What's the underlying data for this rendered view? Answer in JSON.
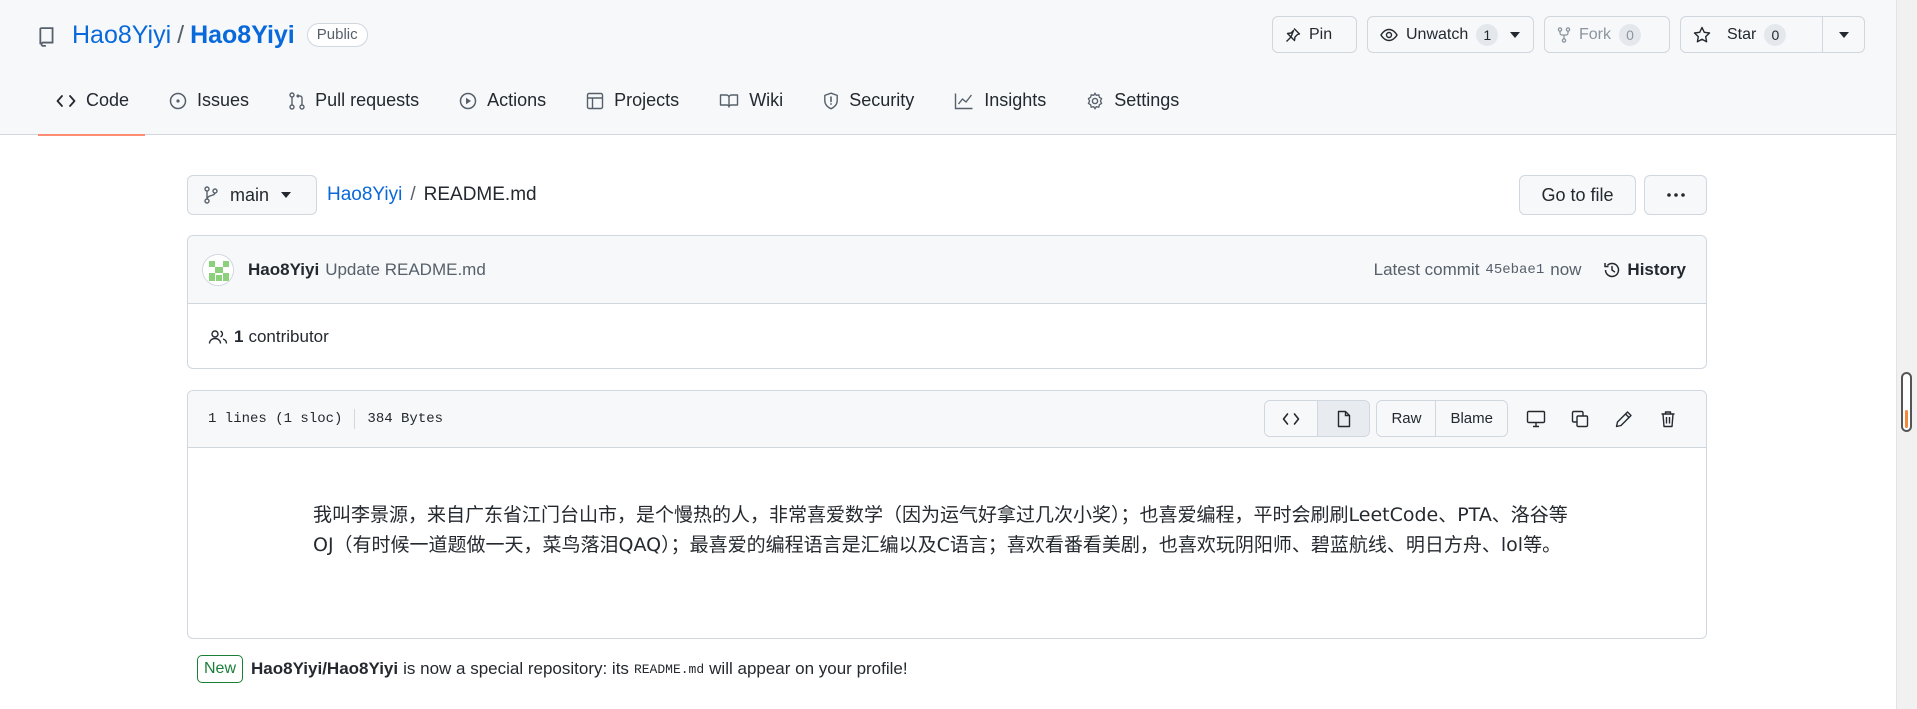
{
  "repo": {
    "owner": "Hao8Yiyi",
    "separator": "/",
    "name": "Hao8Yiyi",
    "visibility": "Public"
  },
  "header_actions": {
    "pin_label": "Pin",
    "unwatch_label": "Unwatch",
    "unwatch_count": "1",
    "fork_label": "Fork",
    "fork_count": "0",
    "star_label": "Star",
    "star_count": "0"
  },
  "tabs": [
    {
      "label": "Code",
      "icon": "code-icon",
      "active": true
    },
    {
      "label": "Issues",
      "icon": "issue-icon"
    },
    {
      "label": "Pull requests",
      "icon": "pull-request-icon"
    },
    {
      "label": "Actions",
      "icon": "play-icon"
    },
    {
      "label": "Projects",
      "icon": "table-icon"
    },
    {
      "label": "Wiki",
      "icon": "book-icon"
    },
    {
      "label": "Security",
      "icon": "shield-icon"
    },
    {
      "label": "Insights",
      "icon": "graph-icon"
    },
    {
      "label": "Settings",
      "icon": "gear-icon"
    }
  ],
  "file_nav": {
    "branch": "main",
    "crumb_owner": "Hao8Yiyi",
    "crumb_sep": "/",
    "crumb_file": "README.md",
    "goto_label": "Go to file"
  },
  "commit": {
    "author": "Hao8Yiyi",
    "message": "Update README.md",
    "latest_label": "Latest commit",
    "sha": "45ebae1",
    "time": "now",
    "history_label": "History"
  },
  "contributors": {
    "count": "1",
    "label": "contributor"
  },
  "file": {
    "lines": "1 lines (1 sloc)",
    "size": "384 Bytes",
    "raw_label": "Raw",
    "blame_label": "Blame",
    "content": "我叫李景源，来自广东省江门台山市，是个慢热的人，非常喜爱数学（因为运气好拿过几次小奖）；也喜爱编程，平时会刷刷LeetCode、PTA、洛谷等OJ（有时候一道题做一天，菜鸟落泪QAQ）；最喜爱的编程语言是汇编以及C语言；喜欢看番看美剧，也喜欢玩阴阳师、碧蓝航线、明日方舟、lol等。"
  },
  "notice": {
    "badge": "New",
    "repo": "Hao8Yiyi/Hao8Yiyi",
    "text_before": "is now a special repository: its",
    "code": "README.md",
    "text_after": "will appear on your profile!"
  },
  "colors": {
    "link": "#0969da",
    "active_tab_underline": "#fd8c73",
    "new_badge": "#1a7f37"
  }
}
